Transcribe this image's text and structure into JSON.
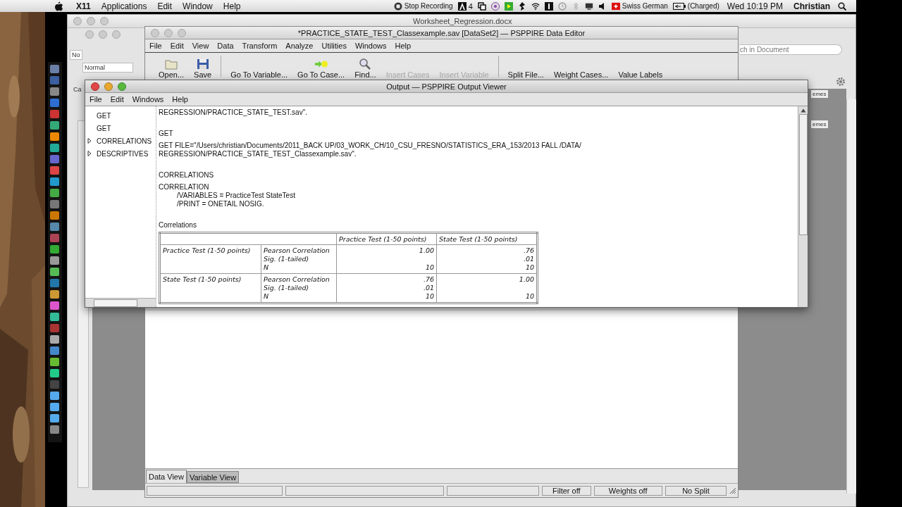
{
  "menubar": {
    "app": "X11",
    "items": [
      "Applications",
      "Edit",
      "Window",
      "Help"
    ],
    "recording": "Stop Recording",
    "adobe_count": "4",
    "input_source": "Swiss German",
    "battery": "(Charged)",
    "clock": "Wed 10:19 PM",
    "user": "Christian"
  },
  "word_window": {
    "title": "Worksheet_Regression.docx",
    "style_field": "Normal",
    "font_fragment": "No",
    "side_fragment": "Ca",
    "search_placeholder": "ch in Document",
    "themes_fragments": [
      "emes",
      "emes"
    ]
  },
  "data_editor": {
    "title": "*PRACTICE_STATE_TEST_Classexample.sav [DataSet2] — PSPPIRE Data Editor",
    "menu": [
      "File",
      "Edit",
      "View",
      "Data",
      "Transform",
      "Analyze",
      "Utilities",
      "Windows",
      "Help"
    ],
    "toolbar": [
      {
        "label": "Open...",
        "disabled": false
      },
      {
        "label": "Save",
        "disabled": false
      },
      {
        "label": "Go To Variable...",
        "disabled": false
      },
      {
        "label": "Go To Case...",
        "disabled": false
      },
      {
        "label": "Find...",
        "disabled": false
      },
      {
        "label": "Insert Cases",
        "disabled": true
      },
      {
        "label": "Insert Variable",
        "disabled": true
      },
      {
        "label": "Split File...",
        "disabled": false
      },
      {
        "label": "Weight Cases...",
        "disabled": false
      },
      {
        "label": "Value Labels",
        "disabled": false
      }
    ],
    "tabs": [
      {
        "label": "Data View",
        "selected": true
      },
      {
        "label": "Variable View",
        "selected": false
      }
    ],
    "status_bar": [
      "Filter off",
      "Weights off",
      "No Split"
    ]
  },
  "output_viewer": {
    "title": "Output — PSPPIRE Output Viewer",
    "menu": [
      "File",
      "Edit",
      "Windows",
      "Help"
    ],
    "outline": [
      {
        "label": "GET",
        "expandable": false
      },
      {
        "label": "GET",
        "expandable": false
      },
      {
        "label": "CORRELATIONS",
        "expandable": true
      },
      {
        "label": "DESCRIPTIVES",
        "expandable": true
      }
    ],
    "log": [
      [
        {
          "text": "REGRESSION/PRACTICE_STATE_TEST.sav\".",
          "kind": "cmd"
        }
      ],
      [
        {
          "text": "GET",
          "kind": "heading"
        }
      ],
      [
        {
          "text": "GET FILE=\"/Users/christian/Documents/2011_BACK UP/03_WORK_CH/10_CSU_FRESNO/STATISTICS_ERA_153/2013 FALL /DATA/",
          "kind": "cmd"
        },
        {
          "text": "REGRESSION/PRACTICE_STATE_TEST_Classexample.sav\".",
          "kind": "cmd"
        }
      ],
      [
        {
          "text": "CORRELATIONS",
          "kind": "heading"
        }
      ],
      [
        {
          "text": "CORRELATION",
          "kind": "cmd"
        },
        {
          "text": "/VARIABLES =  PracticeTest StateTest",
          "kind": "sub"
        },
        {
          "text": "/PRINT = ONETAIL NOSIG.",
          "kind": "sub"
        }
      ]
    ],
    "table": {
      "title": "Correlations",
      "columns": [
        "Practice Test (1-50 points)",
        "State Test (1-50 points)"
      ],
      "rows": [
        {
          "label": "Practice Test (1-50 points)",
          "stats": [
            "Pearson Correlation",
            "Sig. (1-tailed)",
            "N"
          ],
          "values": [
            {
              "r": "1.00",
              "n": "10"
            },
            {
              "r": ".76",
              "sig": ".01",
              "n": "10"
            }
          ]
        },
        {
          "label": "State Test (1-50 points)",
          "stats": [
            "Pearson Correlation",
            "Sig. (1-tailed)",
            "N"
          ],
          "values": [
            {
              "r": ".76",
              "sig": ".01",
              "n": "10"
            },
            {
              "r": "1.00",
              "n": "10"
            }
          ]
        }
      ]
    }
  }
}
